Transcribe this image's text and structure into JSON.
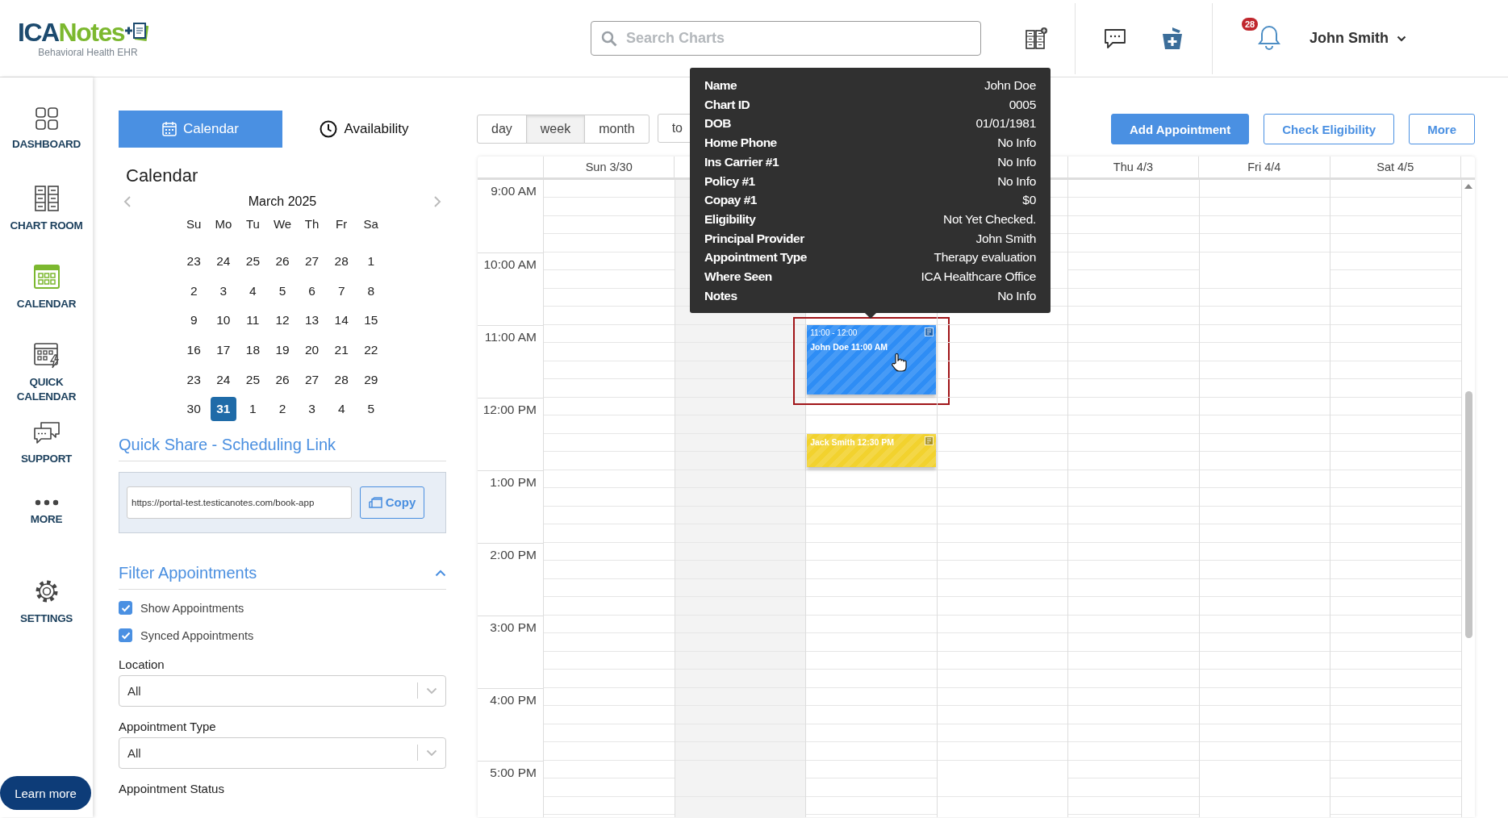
{
  "header": {
    "logo": {
      "parts": [
        "ICA",
        "Notes"
      ],
      "tagline": "Behavioral Health EHR"
    },
    "search": {
      "placeholder": "Search Charts"
    },
    "notifications": {
      "count": "28"
    },
    "user": {
      "name": "John Smith"
    }
  },
  "nav": [
    {
      "label": "DASHBOARD",
      "kind": "dashboard",
      "selected": false
    },
    {
      "label": "CHART ROOM",
      "kind": "cabinet",
      "selected": false
    },
    {
      "label": "CALENDAR",
      "kind": "calendar",
      "selected": true
    },
    {
      "label": "QUICK CALENDAR",
      "kind": "quick",
      "selected": false
    },
    {
      "label": "SUPPORT",
      "kind": "support",
      "selected": false
    },
    {
      "label": "MORE",
      "kind": "more",
      "selected": false
    },
    {
      "label": "SETTINGS",
      "kind": "settings",
      "selected": false
    }
  ],
  "learn_more": "Learn more",
  "panel": {
    "tabs": [
      {
        "label": "Calendar",
        "kind": "calendar",
        "selected": true
      },
      {
        "label": "Availability",
        "kind": "clock",
        "selected": false
      }
    ],
    "calendar": {
      "title": "Calendar",
      "month": "March 2025",
      "weekdays": [
        "Su",
        "Mo",
        "Tu",
        "We",
        "Th",
        "Fr",
        "Sa"
      ],
      "weeks": [
        [
          {
            "d": "23",
            "selected": false
          },
          {
            "d": "24",
            "selected": false
          },
          {
            "d": "25",
            "selected": false
          },
          {
            "d": "26",
            "selected": false
          },
          {
            "d": "27",
            "selected": false
          },
          {
            "d": "28",
            "selected": false
          },
          {
            "d": "1",
            "selected": false
          }
        ],
        [
          {
            "d": "2",
            "selected": false
          },
          {
            "d": "3",
            "selected": false
          },
          {
            "d": "4",
            "selected": false
          },
          {
            "d": "5",
            "selected": false
          },
          {
            "d": "6",
            "selected": false
          },
          {
            "d": "7",
            "selected": false
          },
          {
            "d": "8",
            "selected": false
          }
        ],
        [
          {
            "d": "9",
            "selected": false
          },
          {
            "d": "10",
            "selected": false
          },
          {
            "d": "11",
            "selected": false
          },
          {
            "d": "12",
            "selected": false
          },
          {
            "d": "13",
            "selected": false
          },
          {
            "d": "14",
            "selected": false
          },
          {
            "d": "15",
            "selected": false
          }
        ],
        [
          {
            "d": "16",
            "selected": false
          },
          {
            "d": "17",
            "selected": false
          },
          {
            "d": "18",
            "selected": false
          },
          {
            "d": "19",
            "selected": false
          },
          {
            "d": "20",
            "selected": false
          },
          {
            "d": "21",
            "selected": false
          },
          {
            "d": "22",
            "selected": false
          }
        ],
        [
          {
            "d": "23",
            "selected": false
          },
          {
            "d": "24",
            "selected": false
          },
          {
            "d": "25",
            "selected": false
          },
          {
            "d": "26",
            "selected": false
          },
          {
            "d": "27",
            "selected": false
          },
          {
            "d": "28",
            "selected": false
          },
          {
            "d": "29",
            "selected": false
          }
        ],
        [
          {
            "d": "30",
            "selected": false
          },
          {
            "d": "31",
            "selected": true
          },
          {
            "d": "1",
            "selected": false
          },
          {
            "d": "2",
            "selected": false
          },
          {
            "d": "3",
            "selected": false
          },
          {
            "d": "4",
            "selected": false
          },
          {
            "d": "5",
            "selected": false
          }
        ]
      ]
    },
    "share": {
      "title": "Quick Share - Scheduling Link",
      "url": "https://portal-test.testicanotes.com/book-app",
      "copy": "Copy"
    },
    "filters": {
      "title": "Filter Appointments",
      "expanded": true,
      "checks": [
        {
          "label": "Show Appointments",
          "checked": true
        },
        {
          "label": "Synced Appointments",
          "checked": true
        }
      ],
      "selects": [
        {
          "label": "Location",
          "value": "All"
        },
        {
          "label": "Appointment Type",
          "value": "All"
        }
      ],
      "next_label": "Appointment Status"
    }
  },
  "toolbar": {
    "views": [
      {
        "label": "day",
        "selected": false
      },
      {
        "label": "week",
        "selected": true
      },
      {
        "label": "month",
        "selected": false
      }
    ],
    "today": "to",
    "actions": [
      {
        "label": "Add Appointment",
        "kind": "primary"
      },
      {
        "label": "Check Eligibility",
        "kind": "outline"
      },
      {
        "label": "More",
        "kind": "outline"
      }
    ]
  },
  "grid": {
    "hours": [
      "9:00 AM",
      "10:00 AM",
      "11:00 AM",
      "12:00 PM",
      "1:00 PM",
      "2:00 PM",
      "3:00 PM",
      "4:00 PM",
      "5:00 PM"
    ],
    "days": [
      {
        "label": "Sun 3/30",
        "today": false
      },
      {
        "today": true
      },
      {
        "today": false,
        "events": [
          {
            "time": "11:00 - 12:00",
            "title": "John Doe 11:00 AM",
            "color": "#2e8df5",
            "highlighted": true
          },
          {
            "title": "Jack Smith 12:30 PM",
            "color": "#f2d22e",
            "highlighted": false
          }
        ]
      },
      {
        "today": false
      },
      {
        "label": "Thu 4/3",
        "today": false
      },
      {
        "label": "Fri 4/4",
        "today": false
      },
      {
        "label": "Sat 4/5",
        "today": false
      }
    ]
  },
  "tooltip": {
    "rows": [
      {
        "label": "Name",
        "value": "John Doe"
      },
      {
        "label": "Chart ID",
        "value": "0005"
      },
      {
        "label": "DOB",
        "value": "01/01/1981"
      },
      {
        "label": "Home Phone",
        "value": "No Info"
      },
      {
        "label": "Ins Carrier #1",
        "value": "No Info"
      },
      {
        "label": "Policy #1",
        "value": "No Info"
      },
      {
        "label": "Copay #1",
        "value": "$0"
      },
      {
        "label": "Eligibility",
        "value": "Not Yet Checked."
      },
      {
        "label": "Principal Provider",
        "value": "John Smith"
      },
      {
        "label": "Appointment Type",
        "value": "Therapy evaluation"
      },
      {
        "label": "Where Seen",
        "value": "ICA Healthcare Office"
      },
      {
        "label": "Notes",
        "value": "No Info"
      }
    ]
  }
}
